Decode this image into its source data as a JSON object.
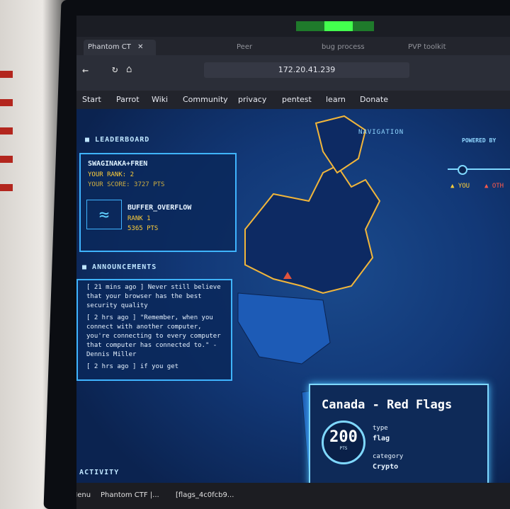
{
  "browser": {
    "tabs": [
      {
        "label": "Phantom CT",
        "active": true
      },
      {
        "label": "Peer",
        "active": false
      },
      {
        "label": "bug process",
        "active": false
      },
      {
        "label": "PVP toolkit",
        "active": false
      }
    ],
    "url": "172.20.41.239",
    "bookmarks": [
      "Start",
      "Parrot",
      "Wiki",
      "Community",
      "privacy",
      "pentest",
      "learn",
      "Donate"
    ]
  },
  "sidebar": {
    "leaderboard_title": "LEADERBOARD",
    "player": {
      "name": "SWAGINAKA+FREN",
      "rank": "YOUR RANK: 2",
      "score": "YOUR SCORE: 3727 PTS"
    },
    "top_team": {
      "name": "BUFFER_OVERFLOW",
      "rank": "RANK 1",
      "score": "5365 PTS"
    },
    "announcements_title": "ANNOUNCEMENTS",
    "announcements": [
      "[ 21 mins ago ] Never still believe that your browser has the best security quality",
      "[ 2 hrs ago ] \"Remember, when you connect with another computer, you're connecting to every computer that computer has connected to.\" - Dennis Miller",
      "[ 2 hrs ago ] if you get"
    ],
    "activity_title": "ACTIVITY"
  },
  "map_panel": {
    "navigation_label": "NAVIGATION",
    "powered_by": "POWERED BY",
    "legend_you": "YOU",
    "legend_other": "OTH",
    "card": {
      "title": "Canada - Red Flags",
      "points": "200",
      "points_unit": "PTS",
      "type_label": "type",
      "type_value": "flag",
      "category_label": "category",
      "category_value": "Crypto"
    }
  },
  "taskbar": {
    "menu": "Menu",
    "items": [
      "Phantom CTF |...",
      "[flags_4c0fcb9..."
    ]
  },
  "colors": {
    "accent": "#3fb4ff",
    "map_highlight": "#f2b63a",
    "flag_red": "#e0533c"
  }
}
